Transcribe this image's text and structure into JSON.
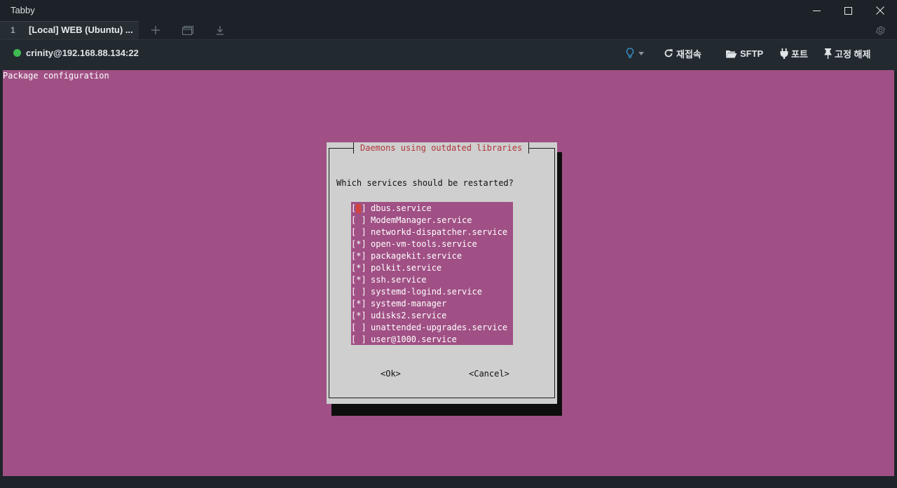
{
  "window": {
    "title": "Tabby"
  },
  "tabs": [
    {
      "number": "1",
      "label": "[Local] WEB (Ubuntu) ..."
    }
  ],
  "tab_actions": {
    "new_tab_icon": "plus-icon",
    "split_icon": "window-icon",
    "download_icon": "download-icon",
    "settings_icon": "gear-icon"
  },
  "toolbar": {
    "connection_status_color": "#3fb950",
    "connection_label": "crinity@192.168.88.134:22",
    "reconnect_label": "재접속",
    "sftp_label": "SFTP",
    "ports_label": "포트",
    "unpin_label": "고정 해제"
  },
  "terminal": {
    "background_color": "#a05085",
    "header": "Package configuration",
    "dialog": {
      "title": "Daemons using outdated libraries",
      "title_color": "#b0343a",
      "question": "Which services should be restarted?",
      "items": [
        {
          "mark": "[ ]",
          "name": "dbus.service",
          "focused": true
        },
        {
          "mark": "[ ]",
          "name": "ModemManager.service"
        },
        {
          "mark": "[ ]",
          "name": "networkd-dispatcher.service"
        },
        {
          "mark": "[*]",
          "name": "open-vm-tools.service"
        },
        {
          "mark": "[*]",
          "name": "packagekit.service"
        },
        {
          "mark": "[*]",
          "name": "polkit.service"
        },
        {
          "mark": "[*]",
          "name": "ssh.service"
        },
        {
          "mark": "[ ]",
          "name": "systemd-logind.service"
        },
        {
          "mark": "[*]",
          "name": "systemd-manager"
        },
        {
          "mark": "[*]",
          "name": "udisks2.service"
        },
        {
          "mark": "[ ]",
          "name": "unattended-upgrades.service"
        },
        {
          "mark": "[ ]",
          "name": "user@1000.service"
        }
      ],
      "ok_label": "<Ok>",
      "cancel_label": "<Cancel>"
    }
  }
}
